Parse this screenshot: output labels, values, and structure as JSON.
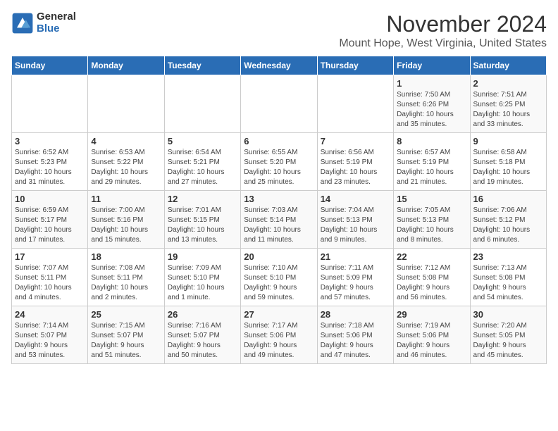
{
  "logo": {
    "general": "General",
    "blue": "Blue"
  },
  "title": "November 2024",
  "location": "Mount Hope, West Virginia, United States",
  "days_of_week": [
    "Sunday",
    "Monday",
    "Tuesday",
    "Wednesday",
    "Thursday",
    "Friday",
    "Saturday"
  ],
  "weeks": [
    [
      {
        "day": "",
        "info": ""
      },
      {
        "day": "",
        "info": ""
      },
      {
        "day": "",
        "info": ""
      },
      {
        "day": "",
        "info": ""
      },
      {
        "day": "",
        "info": ""
      },
      {
        "day": "1",
        "info": "Sunrise: 7:50 AM\nSunset: 6:26 PM\nDaylight: 10 hours\nand 35 minutes."
      },
      {
        "day": "2",
        "info": "Sunrise: 7:51 AM\nSunset: 6:25 PM\nDaylight: 10 hours\nand 33 minutes."
      }
    ],
    [
      {
        "day": "3",
        "info": "Sunrise: 6:52 AM\nSunset: 5:23 PM\nDaylight: 10 hours\nand 31 minutes."
      },
      {
        "day": "4",
        "info": "Sunrise: 6:53 AM\nSunset: 5:22 PM\nDaylight: 10 hours\nand 29 minutes."
      },
      {
        "day": "5",
        "info": "Sunrise: 6:54 AM\nSunset: 5:21 PM\nDaylight: 10 hours\nand 27 minutes."
      },
      {
        "day": "6",
        "info": "Sunrise: 6:55 AM\nSunset: 5:20 PM\nDaylight: 10 hours\nand 25 minutes."
      },
      {
        "day": "7",
        "info": "Sunrise: 6:56 AM\nSunset: 5:19 PM\nDaylight: 10 hours\nand 23 minutes."
      },
      {
        "day": "8",
        "info": "Sunrise: 6:57 AM\nSunset: 5:19 PM\nDaylight: 10 hours\nand 21 minutes."
      },
      {
        "day": "9",
        "info": "Sunrise: 6:58 AM\nSunset: 5:18 PM\nDaylight: 10 hours\nand 19 minutes."
      }
    ],
    [
      {
        "day": "10",
        "info": "Sunrise: 6:59 AM\nSunset: 5:17 PM\nDaylight: 10 hours\nand 17 minutes."
      },
      {
        "day": "11",
        "info": "Sunrise: 7:00 AM\nSunset: 5:16 PM\nDaylight: 10 hours\nand 15 minutes."
      },
      {
        "day": "12",
        "info": "Sunrise: 7:01 AM\nSunset: 5:15 PM\nDaylight: 10 hours\nand 13 minutes."
      },
      {
        "day": "13",
        "info": "Sunrise: 7:03 AM\nSunset: 5:14 PM\nDaylight: 10 hours\nand 11 minutes."
      },
      {
        "day": "14",
        "info": "Sunrise: 7:04 AM\nSunset: 5:13 PM\nDaylight: 10 hours\nand 9 minutes."
      },
      {
        "day": "15",
        "info": "Sunrise: 7:05 AM\nSunset: 5:13 PM\nDaylight: 10 hours\nand 8 minutes."
      },
      {
        "day": "16",
        "info": "Sunrise: 7:06 AM\nSunset: 5:12 PM\nDaylight: 10 hours\nand 6 minutes."
      }
    ],
    [
      {
        "day": "17",
        "info": "Sunrise: 7:07 AM\nSunset: 5:11 PM\nDaylight: 10 hours\nand 4 minutes."
      },
      {
        "day": "18",
        "info": "Sunrise: 7:08 AM\nSunset: 5:11 PM\nDaylight: 10 hours\nand 2 minutes."
      },
      {
        "day": "19",
        "info": "Sunrise: 7:09 AM\nSunset: 5:10 PM\nDaylight: 10 hours\nand 1 minute."
      },
      {
        "day": "20",
        "info": "Sunrise: 7:10 AM\nSunset: 5:10 PM\nDaylight: 9 hours\nand 59 minutes."
      },
      {
        "day": "21",
        "info": "Sunrise: 7:11 AM\nSunset: 5:09 PM\nDaylight: 9 hours\nand 57 minutes."
      },
      {
        "day": "22",
        "info": "Sunrise: 7:12 AM\nSunset: 5:08 PM\nDaylight: 9 hours\nand 56 minutes."
      },
      {
        "day": "23",
        "info": "Sunrise: 7:13 AM\nSunset: 5:08 PM\nDaylight: 9 hours\nand 54 minutes."
      }
    ],
    [
      {
        "day": "24",
        "info": "Sunrise: 7:14 AM\nSunset: 5:07 PM\nDaylight: 9 hours\nand 53 minutes."
      },
      {
        "day": "25",
        "info": "Sunrise: 7:15 AM\nSunset: 5:07 PM\nDaylight: 9 hours\nand 51 minutes."
      },
      {
        "day": "26",
        "info": "Sunrise: 7:16 AM\nSunset: 5:07 PM\nDaylight: 9 hours\nand 50 minutes."
      },
      {
        "day": "27",
        "info": "Sunrise: 7:17 AM\nSunset: 5:06 PM\nDaylight: 9 hours\nand 49 minutes."
      },
      {
        "day": "28",
        "info": "Sunrise: 7:18 AM\nSunset: 5:06 PM\nDaylight: 9 hours\nand 47 minutes."
      },
      {
        "day": "29",
        "info": "Sunrise: 7:19 AM\nSunset: 5:06 PM\nDaylight: 9 hours\nand 46 minutes."
      },
      {
        "day": "30",
        "info": "Sunrise: 7:20 AM\nSunset: 5:05 PM\nDaylight: 9 hours\nand 45 minutes."
      }
    ]
  ]
}
